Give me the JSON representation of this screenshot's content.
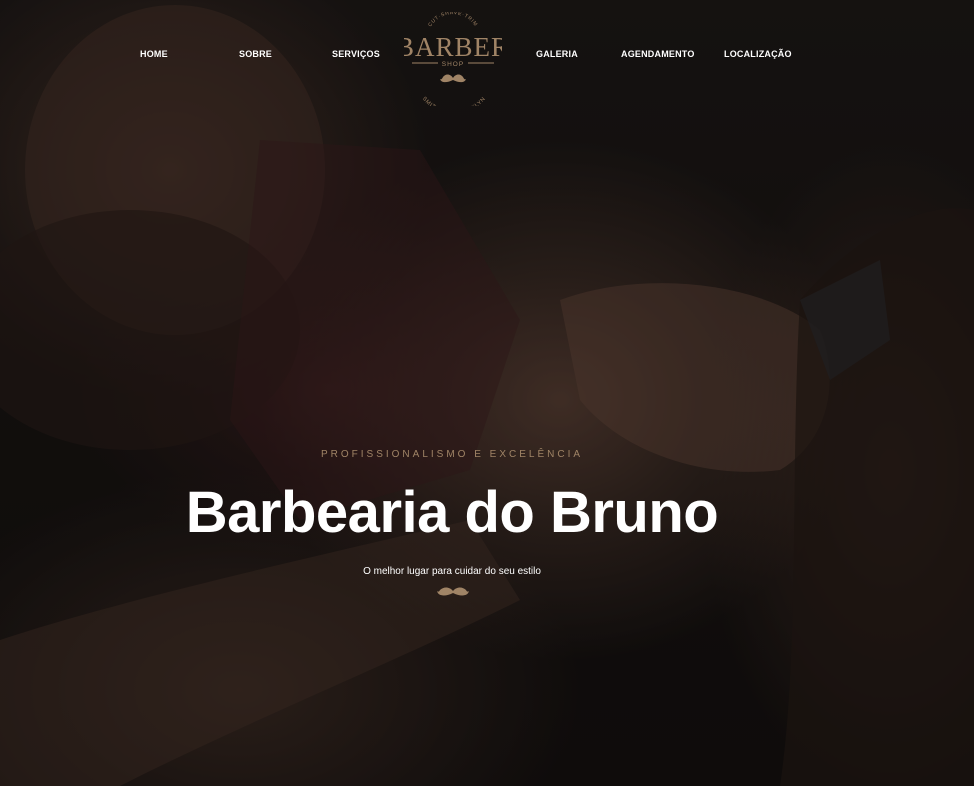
{
  "nav": {
    "left": [
      {
        "label": "HOME"
      },
      {
        "label": "SOBRE"
      },
      {
        "label": "SERVIÇOS"
      }
    ],
    "right": [
      {
        "label": "GALERIA"
      },
      {
        "label": "AGENDAMENTO"
      },
      {
        "label": "LOCALIZAÇÃO"
      }
    ]
  },
  "logo": {
    "top_text": "CUT·SHAVE·TRIM",
    "name": "BARBER",
    "sub": "SHOP",
    "bottom_text": "SMITH ST. BROOKLYN",
    "icon": "mustache-icon"
  },
  "hero": {
    "eyebrow": "PROFISSIONALISMO E EXCELÊNCIA",
    "title": "Barbearia do Bruno",
    "subtitle": "O melhor lugar para cuidar do seu estilo",
    "divider_icon": "mustache-icon"
  },
  "colors": {
    "accent": "#a08466",
    "text": "#ffffff",
    "background": "#14110f"
  }
}
